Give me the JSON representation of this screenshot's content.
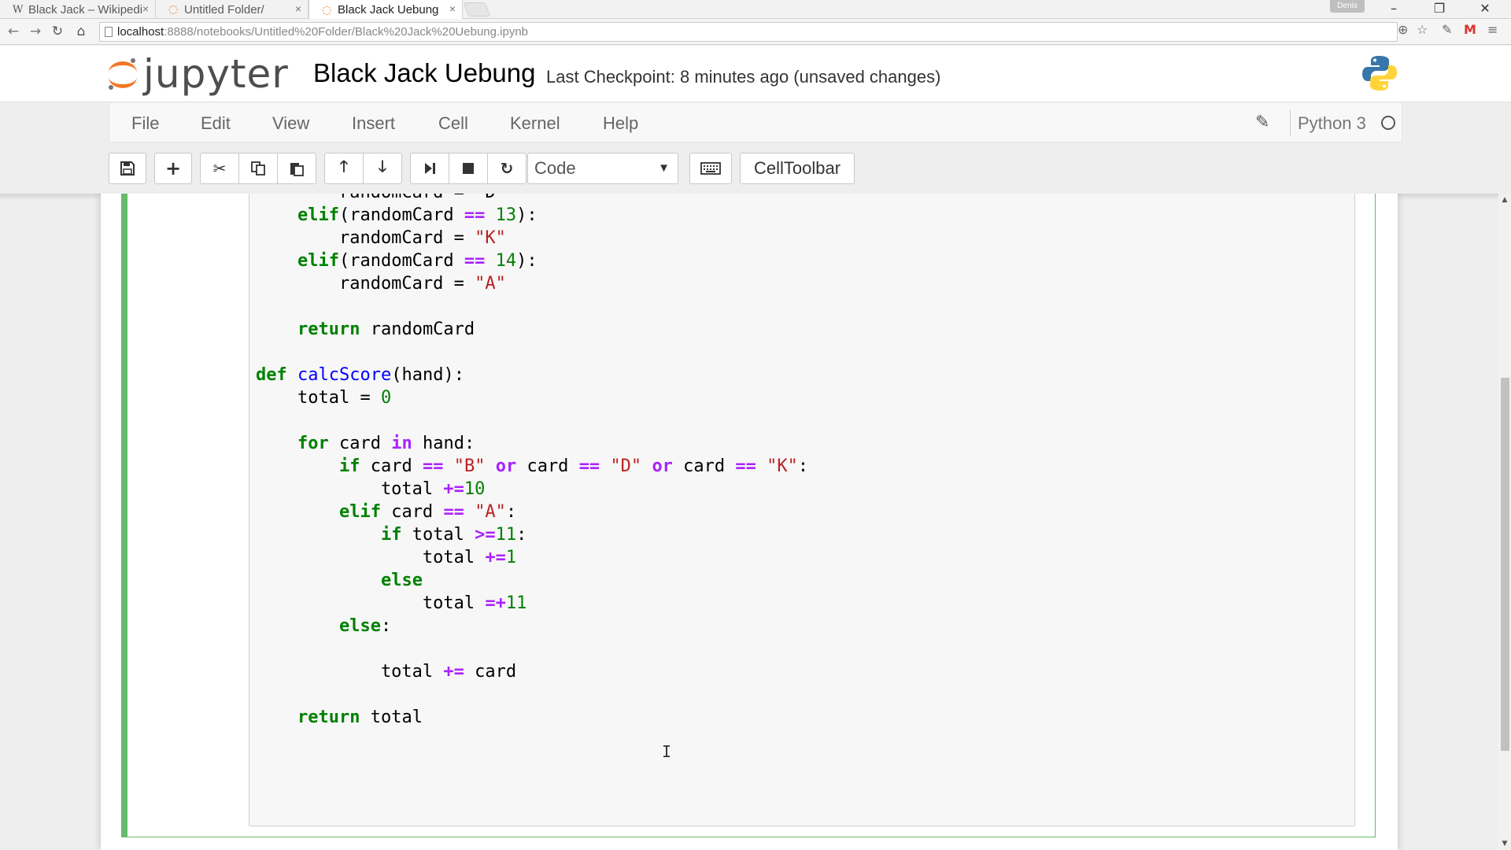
{
  "browser": {
    "tabs": [
      {
        "label": "Black Jack – Wikipedi",
        "favicon": "W",
        "close": "×"
      },
      {
        "label": "Untitled Folder/",
        "favicon": "jupyter-icon",
        "close": "×"
      },
      {
        "label": "Black Jack Uebung",
        "favicon": "jupyter-icon",
        "close": "×"
      }
    ],
    "profile_name": "Denis",
    "window_controls": {
      "minimize": "–",
      "restore": "❐",
      "close": "✕"
    },
    "url_host": "localhost",
    "url_path": ":8888/notebooks/Untitled%20Folder/Black%20Jack%20Uebung.ipynb"
  },
  "header": {
    "logo_text": "jupyter",
    "notebook_title": "Black Jack Uebung",
    "checkpoint_text": "Last Checkpoint: 8 minutes ago (unsaved changes)"
  },
  "menubar": {
    "items": [
      "File",
      "Edit",
      "View",
      "Insert",
      "Cell",
      "Kernel",
      "Help"
    ],
    "kernel_name": "Python 3"
  },
  "toolbar": {
    "cell_type": "Code",
    "celltoolbar_label": "CellToolbar"
  },
  "colors": {
    "cell_border": "#66bb6a",
    "keyword": "#008000",
    "operator": "#aa22ff",
    "string": "#ba2121",
    "function": "#0000ff",
    "jupyter_orange": "#f37726"
  },
  "code_lines": [
    [
      {
        "t": "        randomCard = \"D\"",
        "c": ""
      }
    ],
    [
      {
        "t": "    ",
        "c": ""
      },
      {
        "t": "elif",
        "c": "kw"
      },
      {
        "t": "(randomCard ",
        "c": ""
      },
      {
        "t": "==",
        "c": "op"
      },
      {
        "t": " ",
        "c": ""
      },
      {
        "t": "13",
        "c": "num"
      },
      {
        "t": "):",
        "c": ""
      }
    ],
    [
      {
        "t": "        randomCard = ",
        "c": ""
      },
      {
        "t": "\"K\"",
        "c": "str"
      }
    ],
    [
      {
        "t": "    ",
        "c": ""
      },
      {
        "t": "elif",
        "c": "kw"
      },
      {
        "t": "(randomCard ",
        "c": ""
      },
      {
        "t": "==",
        "c": "op"
      },
      {
        "t": " ",
        "c": ""
      },
      {
        "t": "14",
        "c": "num"
      },
      {
        "t": "):",
        "c": ""
      }
    ],
    [
      {
        "t": "        randomCard = ",
        "c": ""
      },
      {
        "t": "\"A\"",
        "c": "str"
      }
    ],
    [
      {
        "t": "",
        "c": ""
      }
    ],
    [
      {
        "t": "    ",
        "c": ""
      },
      {
        "t": "return",
        "c": "kw"
      },
      {
        "t": " randomCard",
        "c": ""
      }
    ],
    [
      {
        "t": "",
        "c": ""
      }
    ],
    [
      {
        "t": "def",
        "c": "kw"
      },
      {
        "t": " ",
        "c": ""
      },
      {
        "t": "calcScore",
        "c": "fn"
      },
      {
        "t": "(hand):",
        "c": ""
      }
    ],
    [
      {
        "t": "    total = ",
        "c": ""
      },
      {
        "t": "0",
        "c": "num"
      }
    ],
    [
      {
        "t": "",
        "c": ""
      }
    ],
    [
      {
        "t": "    ",
        "c": ""
      },
      {
        "t": "for",
        "c": "kw"
      },
      {
        "t": " card ",
        "c": ""
      },
      {
        "t": "in",
        "c": "op"
      },
      {
        "t": " hand:",
        "c": ""
      }
    ],
    [
      {
        "t": "        ",
        "c": ""
      },
      {
        "t": "if",
        "c": "kw"
      },
      {
        "t": " card ",
        "c": ""
      },
      {
        "t": "==",
        "c": "op"
      },
      {
        "t": " ",
        "c": ""
      },
      {
        "t": "\"B\"",
        "c": "str"
      },
      {
        "t": " ",
        "c": ""
      },
      {
        "t": "or",
        "c": "op"
      },
      {
        "t": " card ",
        "c": ""
      },
      {
        "t": "==",
        "c": "op"
      },
      {
        "t": " ",
        "c": ""
      },
      {
        "t": "\"D\"",
        "c": "str"
      },
      {
        "t": " ",
        "c": ""
      },
      {
        "t": "or",
        "c": "op"
      },
      {
        "t": " card ",
        "c": ""
      },
      {
        "t": "==",
        "c": "op"
      },
      {
        "t": " ",
        "c": ""
      },
      {
        "t": "\"K\"",
        "c": "str"
      },
      {
        "t": ":",
        "c": ""
      }
    ],
    [
      {
        "t": "            total ",
        "c": ""
      },
      {
        "t": "+=",
        "c": "op"
      },
      {
        "t": "10",
        "c": "num"
      }
    ],
    [
      {
        "t": "        ",
        "c": ""
      },
      {
        "t": "elif",
        "c": "kw"
      },
      {
        "t": " card ",
        "c": ""
      },
      {
        "t": "==",
        "c": "op"
      },
      {
        "t": " ",
        "c": ""
      },
      {
        "t": "\"A\"",
        "c": "str"
      },
      {
        "t": ":",
        "c": ""
      }
    ],
    [
      {
        "t": "            ",
        "c": ""
      },
      {
        "t": "if",
        "c": "kw"
      },
      {
        "t": " total ",
        "c": ""
      },
      {
        "t": ">=",
        "c": "op"
      },
      {
        "t": "11",
        "c": "num"
      },
      {
        "t": ":",
        "c": ""
      }
    ],
    [
      {
        "t": "                total ",
        "c": ""
      },
      {
        "t": "+=",
        "c": "op"
      },
      {
        "t": "1",
        "c": "num"
      }
    ],
    [
      {
        "t": "            ",
        "c": ""
      },
      {
        "t": "else",
        "c": "kw"
      }
    ],
    [
      {
        "t": "                total ",
        "c": ""
      },
      {
        "t": "=+",
        "c": "op"
      },
      {
        "t": "11",
        "c": "num"
      }
    ],
    [
      {
        "t": "        ",
        "c": ""
      },
      {
        "t": "else",
        "c": "kw"
      },
      {
        "t": ":",
        "c": ""
      }
    ],
    [
      {
        "t": "",
        "c": ""
      }
    ],
    [
      {
        "t": "            total ",
        "c": ""
      },
      {
        "t": "+=",
        "c": "op"
      },
      {
        "t": " card",
        "c": ""
      }
    ],
    [
      {
        "t": "",
        "c": ""
      }
    ],
    [
      {
        "t": "    ",
        "c": ""
      },
      {
        "t": "return",
        "c": "kw"
      },
      {
        "t": " total",
        "c": ""
      }
    ]
  ]
}
